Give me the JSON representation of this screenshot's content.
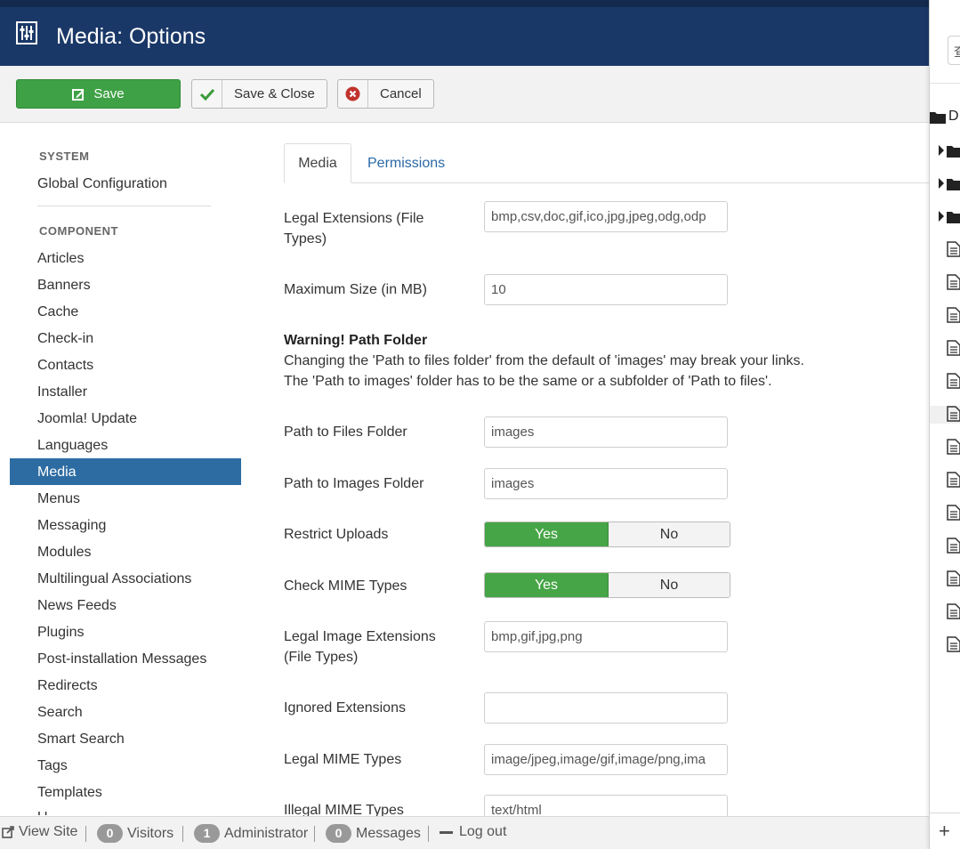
{
  "header": {
    "title": "Media: Options",
    "logo_icon": "sliders-icon"
  },
  "toolbar": {
    "save_label": "Save",
    "save_close_label": "Save & Close",
    "cancel_label": "Cancel"
  },
  "sidebar": {
    "system_heading": "SYSTEM",
    "global_config": "Global Configuration",
    "component_heading": "COMPONENT",
    "items": [
      "Articles",
      "Banners",
      "Cache",
      "Check-in",
      "Contacts",
      "Installer",
      "Joomla! Update",
      "Languages",
      "Media",
      "Menus",
      "Messaging",
      "Modules",
      "Multilingual Associations",
      "News Feeds",
      "Plugins",
      "Post-installation Messages",
      "Redirects",
      "Search",
      "Smart Search",
      "Tags",
      "Templates",
      "U"
    ],
    "active": "Media"
  },
  "tabs": {
    "media": "Media",
    "permissions": "Permissions"
  },
  "form": {
    "legal_ext_label_1": "Legal Extensions (File",
    "legal_ext_label_2": "Types)",
    "legal_ext_value": "bmp,csv,doc,gif,ico,jpg,jpeg,odg,odp",
    "max_size_label": "Maximum Size (in MB)",
    "max_size_value": "10",
    "warning_title": "Warning! Path Folder",
    "warning_line_1": "Changing the 'Path to files folder' from the default of 'images' may break your links.",
    "warning_line_2": "The 'Path to images' folder has to be the same or a subfolder of 'Path to files'.",
    "files_folder_label": "Path to Files Folder",
    "files_folder_value": "images",
    "images_folder_label": "Path to Images Folder",
    "images_folder_value": "images",
    "restrict_label": "Restrict Uploads",
    "mime_check_label": "Check MIME Types",
    "yes": "Yes",
    "no": "No",
    "img_ext_label_1": "Legal Image Extensions",
    "img_ext_label_2": "(File Types)",
    "img_ext_value": "bmp,gif,jpg,png",
    "ignored_label": "Ignored Extensions",
    "ignored_value": "",
    "legal_mime_label": "Legal MIME Types",
    "legal_mime_value": "image/jpeg,image/gif,image/png,ima",
    "illegal_mime_label": "Illegal MIME Types",
    "illegal_mime_value": "text/html"
  },
  "statusbar": {
    "view_site": "View Site",
    "visitors_count": "0",
    "visitors": "Visitors",
    "admin_count": "1",
    "administrator": "Administrator",
    "messages_count": "0",
    "messages": "Messages",
    "logout": "Log out"
  },
  "rightpanel": {
    "search_char": "查",
    "root_label": "D"
  },
  "colors": {
    "navy": "#1a3867",
    "green": "#46a546",
    "active_blue": "#2d6ca2",
    "link_blue": "#2a69a6"
  }
}
